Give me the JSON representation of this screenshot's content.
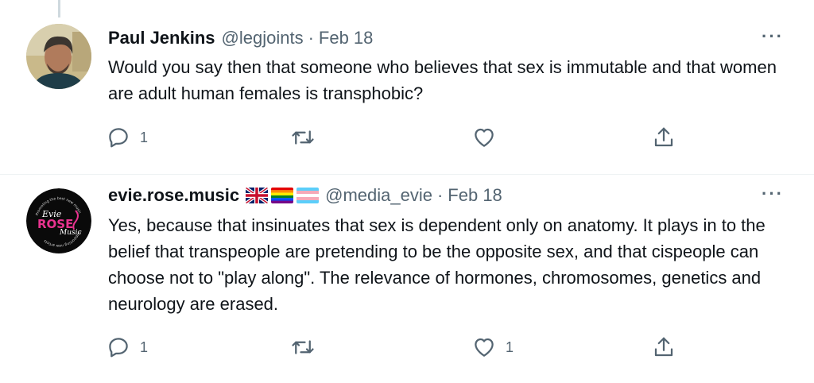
{
  "tweets": [
    {
      "name": "Paul Jenkins",
      "handle": "@legjoints",
      "separator": "·",
      "date": "Feb 18",
      "more": "···",
      "text": "Would you say then that someone who believes that sex is immutable and that women are adult human females is transphobic?",
      "reply_count": "1",
      "retweet_count": "",
      "like_count": ""
    },
    {
      "name": "evie.rose.music",
      "flags": [
        "uk-flag",
        "rainbow-flag",
        "trans-flag"
      ],
      "handle": "@media_evie",
      "separator": "·",
      "date": "Feb 18",
      "more": "···",
      "text": "Yes, because that insinuates that sex is dependent only on anatomy. It plays in to the belief that transpeople are pretending to be the opposite sex, and that cispeople can choose not to \"play along\". The relevance of hormones, chromosomes, genetics and neurology are erased.",
      "reply_count": "1",
      "retweet_count": "",
      "like_count": "1",
      "avatar_logo": {
        "top_text": "Promoting the best new music",
        "main_text": "Evie ROSE Music",
        "bottom_text": "Supporting new artists"
      }
    }
  ],
  "colors": {
    "text": "#0f1419",
    "secondary": "#536471",
    "divider": "#eff3f4",
    "logo_pink": "#e8338f"
  }
}
